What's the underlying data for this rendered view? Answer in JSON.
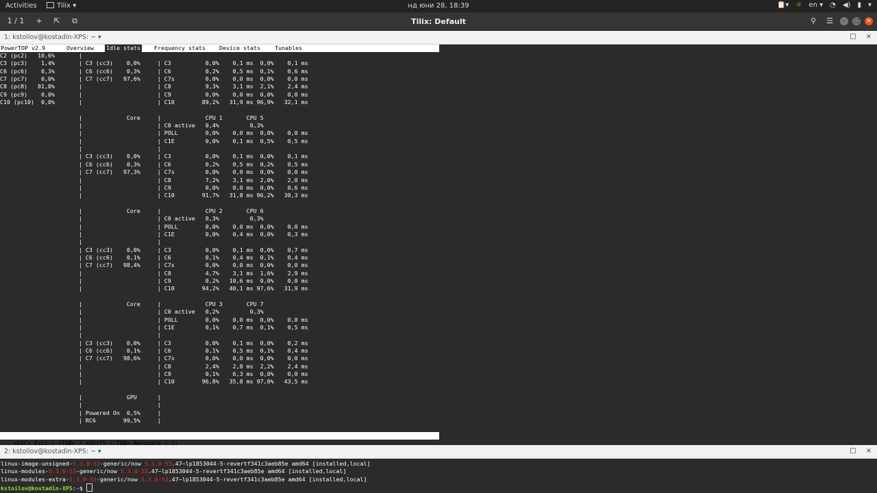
{
  "topbar": {
    "activities": "Activities",
    "app_menu": "Tilix ▾",
    "clock": "нд юни 28, 18:39",
    "language": "en ▾"
  },
  "header": {
    "session_counter": "1 / 1",
    "title": "Tilix: Default"
  },
  "terminal1": {
    "title": "1: kstoilov@kostadin-XPS: ~",
    "menu": [
      {
        "label": "PowerTOP v2.9",
        "active": false
      },
      {
        "label": "Overview",
        "active": false
      },
      {
        "label": "Idle stats",
        "active": true
      },
      {
        "label": "Frequency stats",
        "active": false
      },
      {
        "label": "Device stats",
        "active": false
      },
      {
        "label": "Tunables",
        "active": false
      }
    ],
    "lines": [
      "C2 (pc2)   10,6%       |",
      "C3 (pc3)    1,4%       | C3 (cc3)    0,0%     | C3          0,0%    0,1 ms  0,0%    0,1 ms",
      "C6 (pc6)    0,3%       | C6 (cc6)    0,3%     | C6          0,2%    0,5 ms  0,1%    0,6 ms",
      "C7 (pc7)    0,0%       | C7 (cc7)   97,6%     | C7s         0,0%    0,0 ms  0,0%    0,0 ms",
      "C8 (pc8)   81,8%       |                      | C8          9,3%    3,1 ms  2,1%    2,4 ms",
      "C9 (pc9)    0,0%       |                      | C9          0,0%    0,0 ms  0,0%    0,0 ms",
      "C10 (pc10)  0,0%       |                      | C10        89,2%   31,9 ms 96,9%   32,1 ms",
      "",
      "                       |             Core     |             CPU 1       CPU 5",
      "                       |                      | C0 active   0,4%         0,3%",
      "                       |                      | POLL        0,0%    0,0 ms  0,0%    0,0 ms",
      "                       |                      | C1E         0,0%    0,1 ms  0,5%    0,5 ms",
      "                       |                      |",
      "                       | C3 (cc3)    0,0%     | C3          0,0%    0,1 ms  0,0%    0,1 ms",
      "                       | C6 (cc6)    0,3%     | C6          0,2%    0,5 ms  0,2%    0,5 ms",
      "                       | C7 (cc7)   97,3%     | C7s         0,0%    0,0 ms  0,0%    0,0 ms",
      "                       |                      | C8          7,2%    3,1 ms  2,0%    2,0 ms",
      "                       |                      | C9          0,0%    0,0 ms  0,0%    0,6 ms",
      "                       |                      | C10        91,7%   31,8 ms 96,2%   30,3 ms",
      "",
      "                       |             Core     |             CPU 2       CPU 6",
      "                       |                      | C0 active   0,3%         0,3%",
      "                       |                      | POLL        0,0%    0,0 ms  0,0%    0,0 ms",
      "                       |                      | C1E         0,0%    0,4 ms  0,0%    0,3 ms",
      "                       |                      |",
      "                       | C3 (cc3)    0,0%     | C3          0,0%    0,1 ms  0,0%    0,7 ms",
      "                       | C6 (cc6)    0,1%     | C6          0,1%    0,4 ms  0,1%    0,4 ms",
      "                       | C7 (cc7)   98,4%     | C7s         0,0%    0,0 ms  0,0%    0,0 ms",
      "                       |                      | C8          4,7%    3,1 ms  1,6%    2,9 ms",
      "                       |                      | C9          0,2%   10,6 ms  0,0%    0,0 ms",
      "                       |                      | C10        94,2%   40,1 ms 97,6%   31,9 ms",
      "",
      "                       |             Core     |             CPU 3       CPU 7",
      "                       |                      | C0 active   0,2%         0,3%",
      "                       |                      | POLL        0,0%    0,0 ms  0,0%    0,0 ms",
      "                       |                      | C1E         0,1%    0,7 ms  0,1%    0,5 ms",
      "                       |                      |",
      "                       | C3 (cc3)    0,0%     | C3          0,0%    0,1 ms  0,0%    0,2 ms",
      "                       | C6 (cc6)    0,1%     | C6          0,1%    0,5 ms  0,1%    0,4 ms",
      "                       | C7 (cc7)   98,6%     | C7s         0,0%    0,0 ms  0,0%    0,0 ms",
      "                       |                      | C8          2,4%    2,8 ms  2,2%    2,4 ms",
      "                       |                      | C9          0,1%    6,3 ms  0,0%    0,0 ms",
      "                       |                      | C10        96,8%   35,8 ms 97,0%   43,5 ms",
      "",
      "                       |             GPU      |",
      "                       |                      |",
      "                       | Powered On  0,5%     |",
      "                       | RC6        99,5%     |"
    ],
    "footer": "<ESC> Exit | <TAB> / <Shift + TAB> Navigate | ||"
  },
  "terminal2": {
    "title": "2: kstoilov@kostadin-XPS: ~",
    "lines": [
      {
        "pre": "linux-image-unsigned-",
        "red1": "5.3.0-53",
        "mid": "-generic/now ",
        "red2": "5.3.0-53",
        "post": ".47~lp1853044-5-revertf341c3aeb85e amd64 [installed,local]"
      },
      {
        "pre": "linux-modules-",
        "red1": "5.3.0-53",
        "mid": "-generic/now ",
        "red2": "5.3.0-53",
        "post": ".47~lp1853044-5-revertf341c3aeb85e amd64 [installed,local]"
      },
      {
        "pre": "linux-modules-extra-",
        "red1": "5.3.0-53",
        "mid": "-generic/now ",
        "red2": "5.3.0-53",
        "post": ".47~lp1853044-5-revertf341c3aeb85e amd64 [installed,local]"
      }
    ],
    "prompt_user": "kstoilov@kostadin-XPS",
    "prompt_sep": ":",
    "prompt_path": "~",
    "prompt_end": "$ "
  }
}
